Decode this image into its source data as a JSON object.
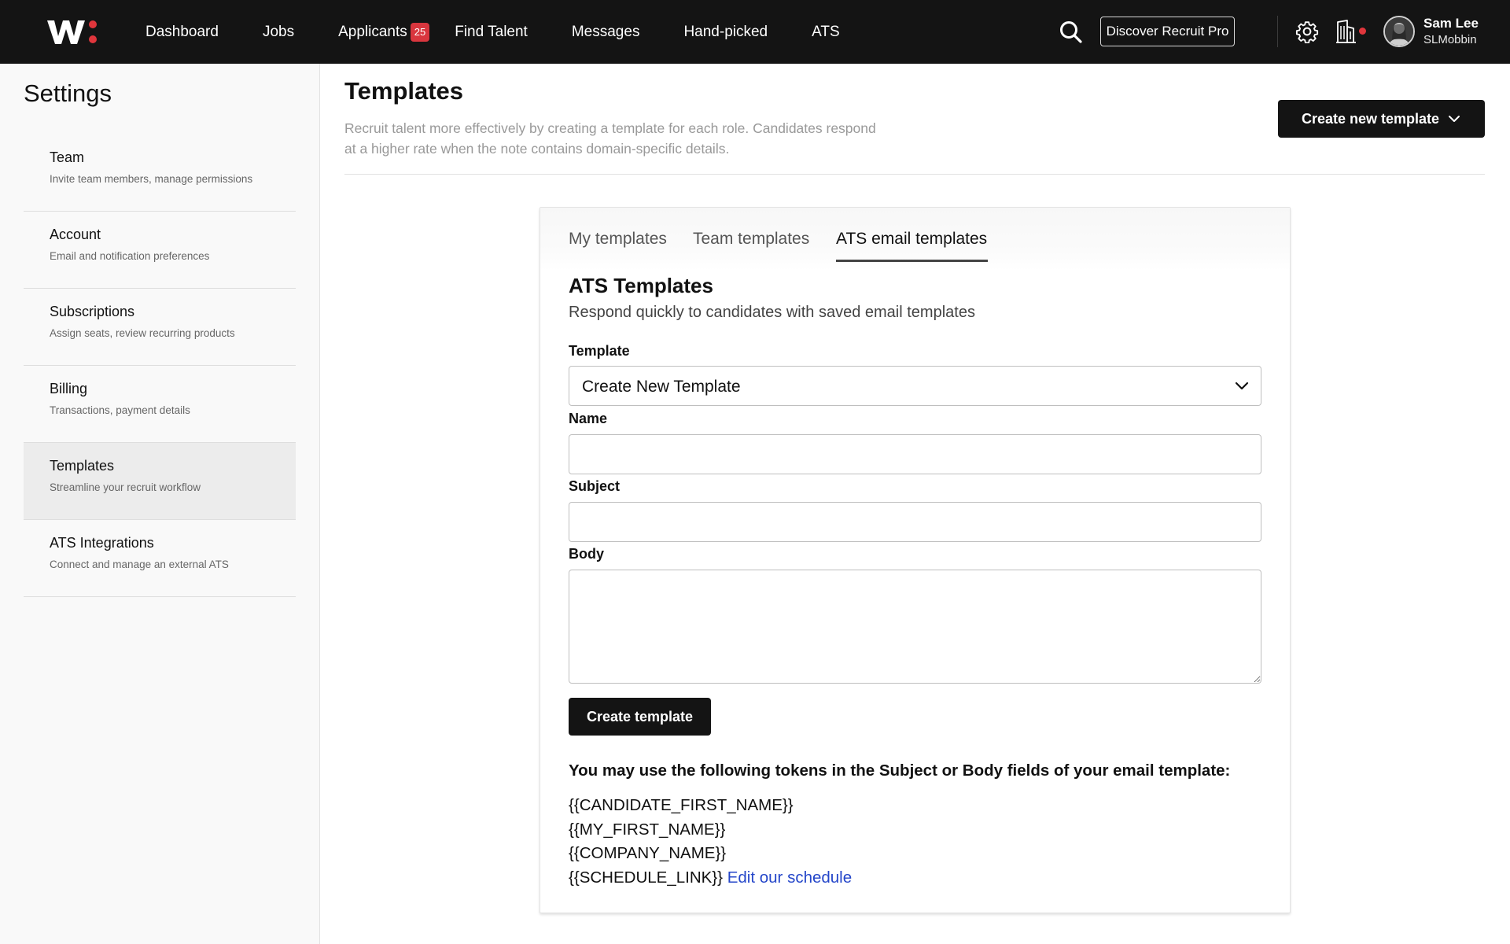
{
  "nav": {
    "logo_alt": "W:",
    "links": [
      {
        "label": "Dashboard"
      },
      {
        "label": "Jobs"
      },
      {
        "label": "Applicants",
        "badge": "25"
      },
      {
        "label": "Find Talent"
      },
      {
        "label": "Messages"
      },
      {
        "label": "Hand-picked"
      },
      {
        "label": "ATS"
      }
    ],
    "discover_label": "Discover Recruit Pro",
    "user": {
      "name": "Sam Lee",
      "handle": "SLMobbin"
    }
  },
  "sidebar": {
    "title": "Settings",
    "items": [
      {
        "label": "Team",
        "desc": "Invite team members, manage permissions"
      },
      {
        "label": "Account",
        "desc": "Email and notification preferences"
      },
      {
        "label": "Subscriptions",
        "desc": "Assign seats, review recurring products"
      },
      {
        "label": "Billing",
        "desc": "Transactions, payment details"
      },
      {
        "label": "Templates",
        "desc": "Streamline your recruit workflow",
        "active": true
      },
      {
        "label": "ATS Integrations",
        "desc": "Connect and manage an external ATS"
      }
    ]
  },
  "main": {
    "title": "Templates",
    "description": "Recruit talent more effectively by creating a template for each role. Candidates respond at a higher rate when the note contains domain-specific details.",
    "create_new_label": "Create new template",
    "tabs": [
      {
        "label": "My templates"
      },
      {
        "label": "Team templates"
      },
      {
        "label": "ATS email templates",
        "active": true
      }
    ],
    "section_title": "ATS Templates",
    "section_subtitle": "Respond quickly to candidates with saved email templates",
    "form": {
      "template_label": "Template",
      "template_value": "Create New Template",
      "name_label": "Name",
      "name_value": "",
      "subject_label": "Subject",
      "subject_value": "",
      "body_label": "Body",
      "body_value": "",
      "submit_label": "Create template"
    },
    "tokens_heading": "You may use the following tokens in the Subject or Body fields of your email template:",
    "tokens": [
      "{{CANDIDATE_FIRST_NAME}}",
      "{{MY_FIRST_NAME}}",
      "{{COMPANY_NAME}}",
      "{{SCHEDULE_LINK}}"
    ],
    "schedule_link_label": "Edit our schedule"
  },
  "colors": {
    "nav_bg": "#141414",
    "badge": "#d9363e",
    "logo_dot": "#e0363c",
    "link": "#2446c9",
    "button_bg": "#141414"
  },
  "icons": [
    "search-icon",
    "gear-icon",
    "building-icon",
    "chevron-down-icon",
    "avatar"
  ]
}
